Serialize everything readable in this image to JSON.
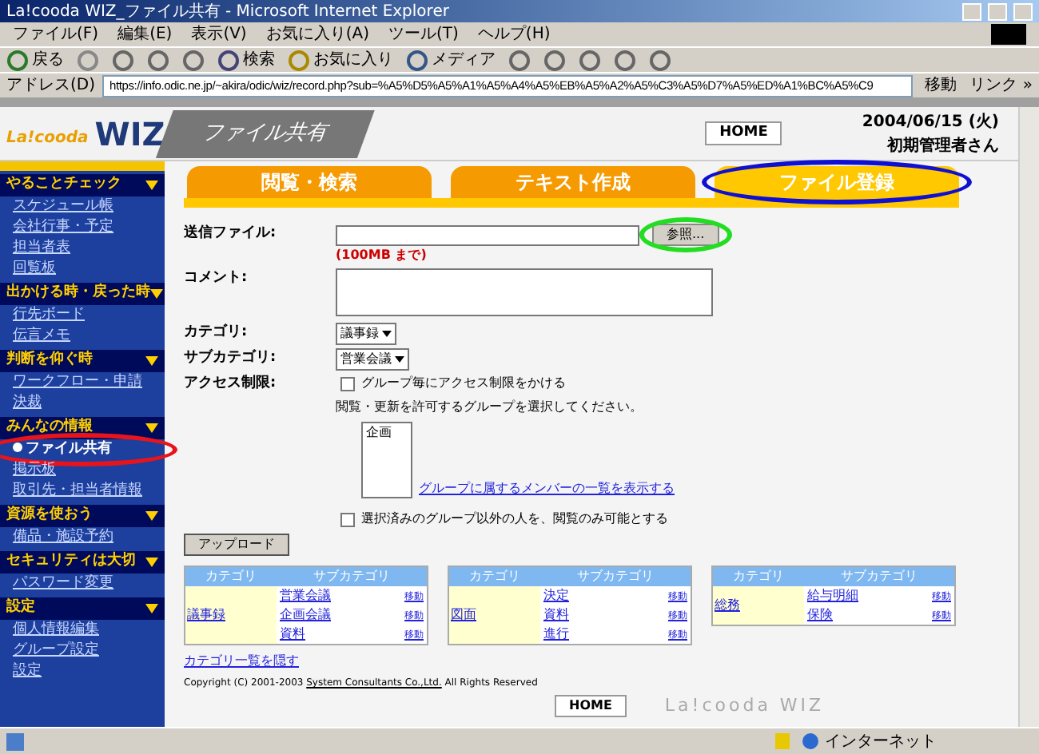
{
  "window": {
    "title": "La!cooda WIZ_ファイル共有 - Microsoft Internet Explorer"
  },
  "menu": [
    "ファイル(F)",
    "編集(E)",
    "表示(V)",
    "お気に入り(A)",
    "ツール(T)",
    "ヘルプ(H)"
  ],
  "toolbar": [
    {
      "kind": "back",
      "label": "戻る"
    },
    {
      "kind": "forward"
    },
    {
      "kind": "stop"
    },
    {
      "kind": "refresh"
    },
    {
      "kind": "home"
    },
    {
      "kind": "search",
      "label": "検索"
    },
    {
      "kind": "favorites",
      "label": "お気に入り"
    },
    {
      "kind": "media",
      "label": "メディア"
    },
    {
      "kind": "history"
    },
    {
      "kind": "mail"
    },
    {
      "kind": "print"
    },
    {
      "kind": "edit"
    },
    {
      "kind": "note"
    }
  ],
  "address": {
    "label": "アドレス(D)",
    "value": "https://info.odic.ne.jp/~akira/odic/wiz/record.php?sub=%A5%D5%A5%A1%A5%A4%A5%EB%A5%A2%A5%C3%A5%D7%A5%ED%A1%BC%A5%C9",
    "go": "移動",
    "links": "リンク »"
  },
  "header": {
    "logo_small": "La!cooda",
    "logo_big": "WIZ",
    "title": "ファイル共有",
    "home": "HOME",
    "date": "2004/06/15 (火)",
    "user": "初期管理者さん"
  },
  "sidebar": [
    {
      "title": "やることチェック",
      "items": [
        {
          "label": "スケジュール帳",
          "selected": false
        },
        {
          "label": "会社行事・予定",
          "selected": false
        },
        {
          "label": "担当者表",
          "selected": false
        },
        {
          "label": "回覧板",
          "selected": false
        }
      ]
    },
    {
      "title": "出かける時・戻った時",
      "items": [
        {
          "label": "行先ボード",
          "selected": false
        },
        {
          "label": "伝言メモ",
          "selected": false
        }
      ]
    },
    {
      "title": "判断を仰ぐ時",
      "items": [
        {
          "label": "ワークフロー・申請",
          "selected": false
        },
        {
          "label": "決裁",
          "selected": false
        }
      ]
    },
    {
      "title": "みんなの情報",
      "items": [
        {
          "label": "ファイル共有",
          "selected": true,
          "color": "#e8141c"
        },
        {
          "label": "掲示板",
          "selected": false
        },
        {
          "label": "取引先・担当者情報",
          "selected": false
        }
      ]
    },
    {
      "title": "資源を使おう",
      "items": [
        {
          "label": "備品・施設予約",
          "selected": false
        }
      ]
    },
    {
      "title": "セキュリティは大切",
      "items": [
        {
          "label": "パスワード変更",
          "selected": false
        }
      ]
    },
    {
      "title": "設定",
      "items": [
        {
          "label": "個人情報編集",
          "selected": false
        },
        {
          "label": "グループ設定",
          "selected": false
        },
        {
          "label": "設定",
          "selected": false
        }
      ]
    }
  ],
  "tabs": [
    {
      "label": "閲覧・検索",
      "selected": false
    },
    {
      "label": "テキスト作成",
      "selected": false
    },
    {
      "label": "ファイル登録",
      "selected": true,
      "color": "#1010d0"
    }
  ],
  "form": {
    "file_label": "送信ファイル:",
    "browse": {
      "label": "参照...",
      "color": "#22dd22"
    },
    "size_note": "(100MB まで)",
    "comment_label": "コメント:",
    "category_label": "カテゴリ:",
    "category_value": "議事録",
    "subcategory_label": "サブカテゴリ:",
    "subcategory_value": "営業会議",
    "access_label": "アクセス制限:",
    "group_restrict": {
      "label": "グループ毎にアクセス制限をかける",
      "checked": false
    },
    "groups_hint": "閲覧・更新を許可するグループを選択してください。",
    "groups": [
      "企画"
    ],
    "members_link": "グループに属するメンバーの一覧を表示する",
    "read_only": {
      "label": "選択済みのグループ以外の人を、閲覧のみ可能とする",
      "checked": false
    },
    "upload": "アップロード"
  },
  "category_tables": [
    {
      "header": [
        "カテゴリ",
        "サブカテゴリ"
      ],
      "category": "議事録",
      "subs": [
        {
          "label": "営業会議",
          "action": "移動"
        },
        {
          "label": "企画会議",
          "action": "移動"
        },
        {
          "label": "資料",
          "action": "移動"
        }
      ]
    },
    {
      "header": [
        "カテゴリ",
        "サブカテゴリ"
      ],
      "category": "図面",
      "subs": [
        {
          "label": "決定",
          "action": "移動"
        },
        {
          "label": "資料",
          "action": "移動"
        },
        {
          "label": "進行",
          "action": "移動"
        }
      ]
    },
    {
      "header": [
        "カテゴリ",
        "サブカテゴリ"
      ],
      "category": "総務",
      "subs": [
        {
          "label": "給与明細",
          "action": "移動"
        },
        {
          "label": "保険",
          "action": "移動"
        }
      ]
    }
  ],
  "hide_link": "カテゴリ一覧を隠す",
  "footer": {
    "copyright_before": "Copyright (C) 2001-2003 ",
    "company": "System Consultants Co.,Ltd.",
    "copyright_after": " All Rights Reserved",
    "home": "HOME",
    "brand": "La!cooda WIZ"
  },
  "status_bar": {
    "zone": "インターネット"
  }
}
